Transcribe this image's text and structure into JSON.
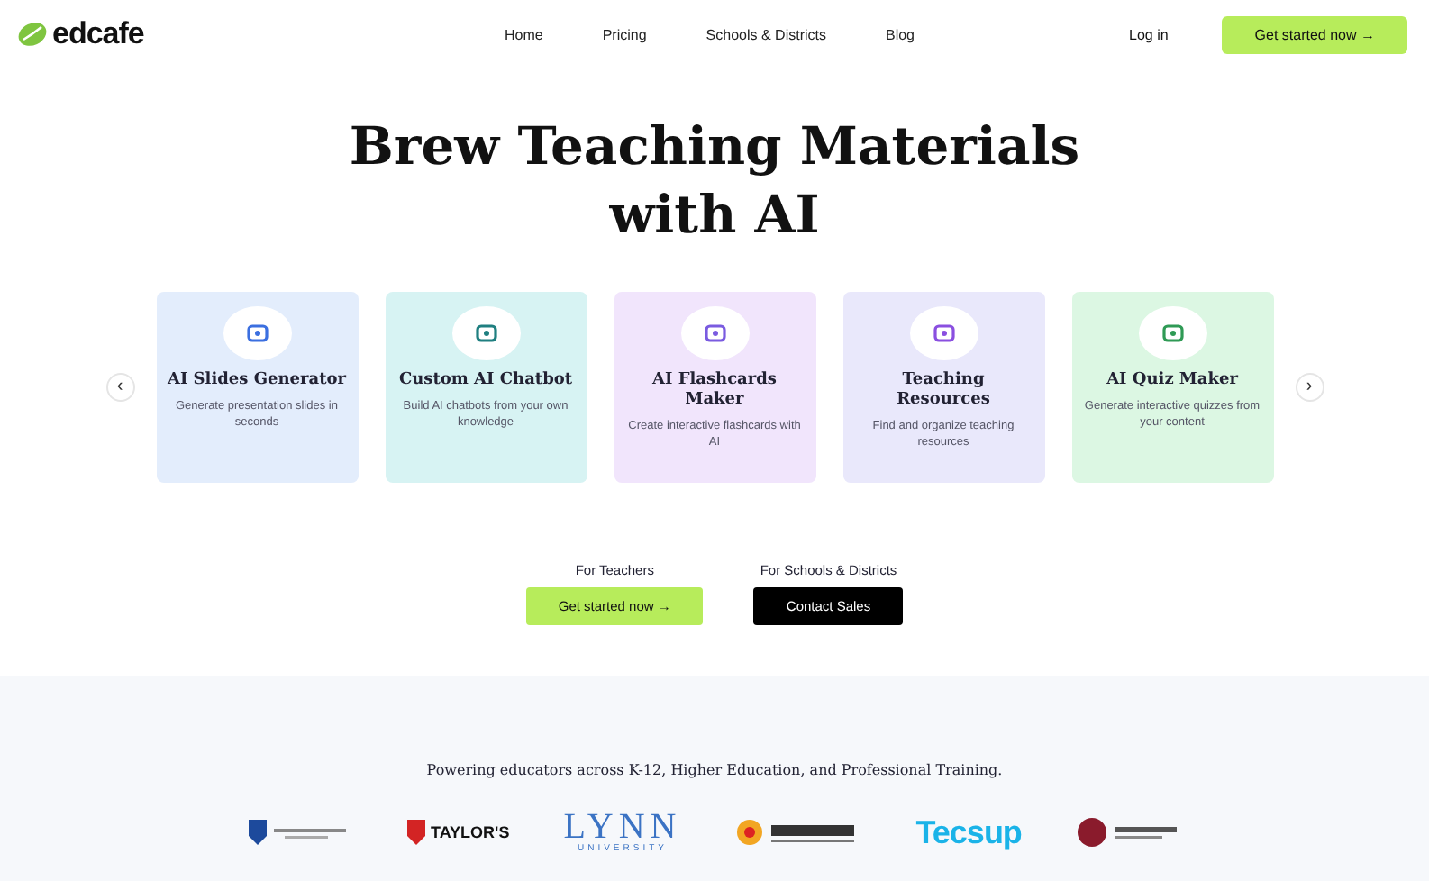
{
  "nav": {
    "logo": "edcafe",
    "links": [
      "Home",
      "Pricing",
      "Schools & Districts",
      "Blog"
    ],
    "login": "Log in",
    "cta": "Get started now →"
  },
  "hero": {
    "title_lines": [
      "Brew Teaching Materials",
      "with AI"
    ]
  },
  "carousel": {
    "prev": "‹",
    "next": "›",
    "cards": [
      {
        "kind": "slides",
        "title": "AI Slides Generator",
        "text": "Generate presentation slides in seconds",
        "color": "#e3edfc"
      },
      {
        "kind": "chatbot",
        "title": "Custom AI Chatbot",
        "text": "Build AI chatbots from your own knowledge",
        "color": "#d7f3f3"
      },
      {
        "kind": "flashcards",
        "title": "AI Flashcards Maker",
        "text": "Create interactive flashcards with AI",
        "color": "#f1e5fc"
      },
      {
        "kind": "resources",
        "title": "Teaching Resources",
        "text": "Find and organize teaching resources",
        "color": "#e9e8fb"
      },
      {
        "kind": "quiz",
        "title": "AI Quiz Maker",
        "text": "Generate interactive quizzes from your content",
        "color": "#dcf7e3"
      }
    ]
  },
  "cta": [
    {
      "kind": "primary",
      "label": "For Teachers",
      "button": "Get started now →"
    },
    {
      "kind": "dark",
      "label": "For Schools & Districts",
      "button": "Contact Sales"
    }
  ],
  "trust": {
    "text": "Powering educators across K-12, Higher Education, and Professional Training.",
    "logos": [
      {
        "kind": "crest"
      },
      {
        "kind": "taylors",
        "text": "TAYLOR'S"
      },
      {
        "kind": "lynn",
        "text": "LYNN",
        "sub": "UNIVERSITY"
      },
      {
        "kind": "flower"
      },
      {
        "kind": "tecsup",
        "text": "Tecsup"
      },
      {
        "kind": "dragon"
      }
    ]
  }
}
